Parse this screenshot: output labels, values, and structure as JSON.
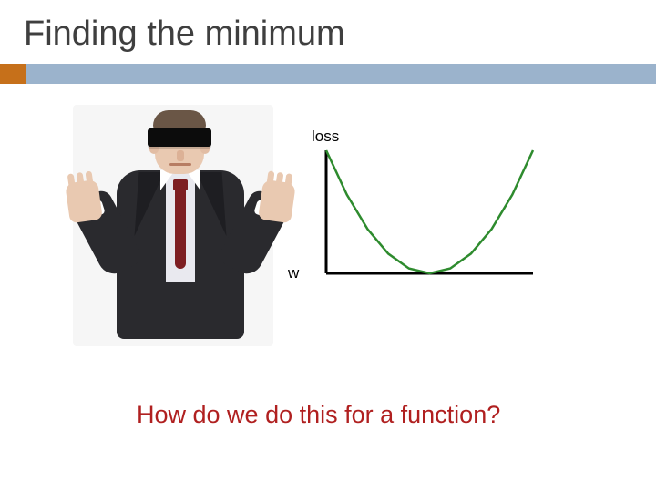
{
  "title": "Finding the minimum",
  "question": "How do we do this for a function?",
  "colors": {
    "accent_bar": "#9bb3cc",
    "accent_tab": "#c6701a",
    "question_text": "#b02020",
    "curve": "#2e8b2e"
  },
  "figure": {
    "description": "blindfolded man in suit with palms out",
    "blindfold_color": "#0c0c0c",
    "suit_color": "#2a2a2e",
    "tie_color": "#7d1e22"
  },
  "chart_data": {
    "type": "line",
    "title": "",
    "xlabel": "w",
    "ylabel": "loss",
    "xlim": [
      -1,
      1
    ],
    "ylim": [
      0,
      1
    ],
    "series": [
      {
        "name": "loss",
        "x": [
          -1.0,
          -0.8,
          -0.6,
          -0.4,
          -0.2,
          0.0,
          0.2,
          0.4,
          0.6,
          0.8,
          1.0
        ],
        "values": [
          1.0,
          0.64,
          0.36,
          0.16,
          0.04,
          0.0,
          0.04,
          0.16,
          0.36,
          0.64,
          1.0
        ]
      }
    ],
    "annotation": "convex curve; minimum near center (w≈0)"
  }
}
